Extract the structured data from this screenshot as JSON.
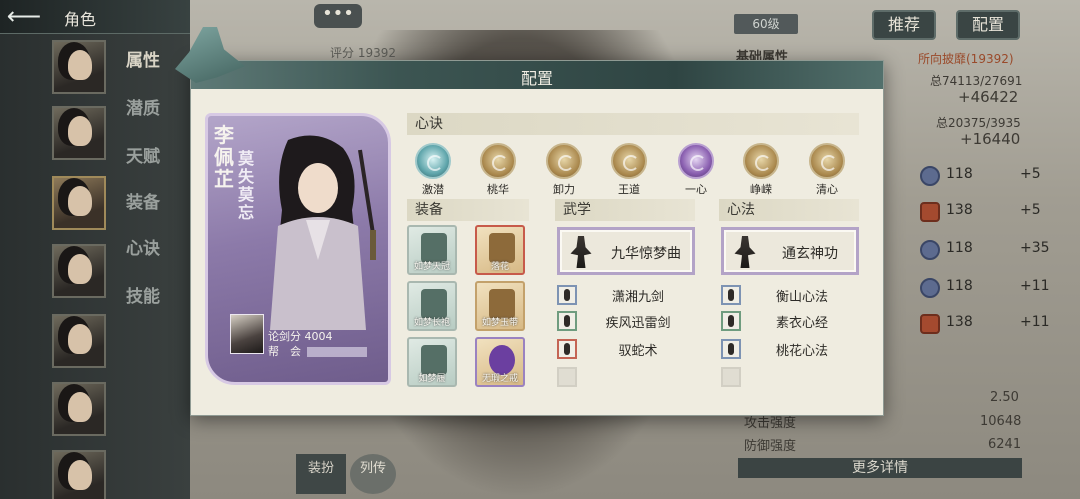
{
  "topbar": {
    "back_icon": "arrow-left-icon",
    "title": "角色"
  },
  "sidebar": {
    "menu": [
      {
        "label": "属性",
        "active": true
      },
      {
        "label": "潜质",
        "active": false
      },
      {
        "label": "天赋",
        "active": false
      },
      {
        "label": "装备",
        "active": false
      },
      {
        "label": "心诀",
        "active": false
      },
      {
        "label": "技能",
        "active": false
      }
    ]
  },
  "background": {
    "more_dots": "•••",
    "score": "评分 19392",
    "level": "60级",
    "recommend_btn": "推荐",
    "config_btn": "配置",
    "base_attr_label": "基础属性",
    "worn_label": "所向披靡(19392)",
    "total_a": "总74113/27691",
    "total_a_delta": "+46422",
    "total_b": "总20375/3935",
    "total_b_delta": "+16440",
    "stats": [
      {
        "value": "118",
        "delta": "+5"
      },
      {
        "value": "138",
        "delta": "+5"
      },
      {
        "value": "118",
        "delta": "+35"
      },
      {
        "value": "118",
        "delta": "+11"
      },
      {
        "value": "138",
        "delta": "+11"
      }
    ],
    "val_250": "2.50",
    "attack_label": "攻击强度",
    "attack_value": "10648",
    "defense_label": "防御强度",
    "defense_value": "6241",
    "more_btn": "更多详情",
    "dress_btn": "装扮",
    "list_btn": "列传"
  },
  "modal": {
    "title": "配置",
    "character": {
      "name": "李佩芷",
      "title": "莫失莫忘",
      "score": "论剑分 4004",
      "guild_label": "帮　会"
    },
    "xinjue": {
      "header": "心诀",
      "items": [
        {
          "label": "激潜",
          "color": "cyan"
        },
        {
          "label": "桃华",
          "color": "gold"
        },
        {
          "label": "卸力",
          "color": "gold"
        },
        {
          "label": "王道",
          "color": "gold"
        },
        {
          "label": "一心",
          "color": "purple"
        },
        {
          "label": "峥嵘",
          "color": "gold"
        },
        {
          "label": "清心",
          "color": "gold"
        }
      ]
    },
    "equipment": {
      "header": "装备",
      "items": [
        {
          "label": "如梦天冠",
          "style": "green"
        },
        {
          "label": "落花",
          "style": "gold"
        },
        {
          "label": "如梦长袍",
          "style": "green"
        },
        {
          "label": "如梦玉带",
          "style": "gold"
        },
        {
          "label": "如梦履",
          "style": "green"
        },
        {
          "label": "无瑕之戒",
          "style": "gold"
        }
      ]
    },
    "martial": {
      "header": "武学",
      "main": "九华惊梦曲",
      "subs": [
        {
          "label": "潇湘九剑",
          "color": "blue"
        },
        {
          "label": "疾风迅雷剑",
          "color": "green"
        },
        {
          "label": "驭蛇术",
          "color": "red"
        },
        {
          "label": "",
          "color": "empty"
        }
      ]
    },
    "mind": {
      "header": "心法",
      "main": "通玄神功",
      "subs": [
        {
          "label": "衡山心法",
          "color": "blue"
        },
        {
          "label": "素衣心经",
          "color": "green"
        },
        {
          "label": "桃花心法",
          "color": "blue"
        },
        {
          "label": "",
          "color": "empty"
        }
      ]
    }
  }
}
